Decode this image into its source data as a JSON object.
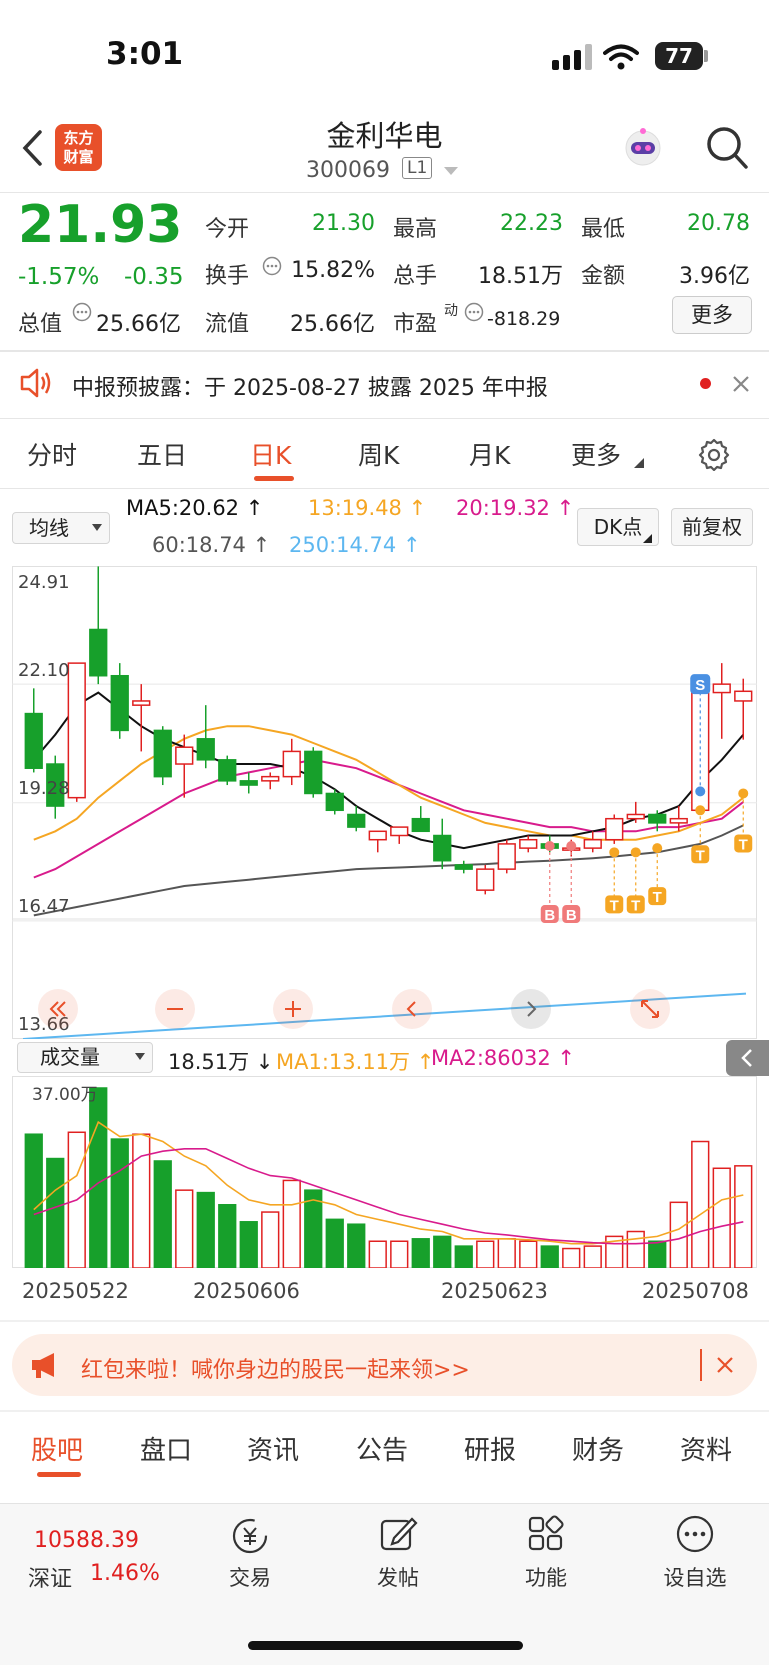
{
  "status": {
    "time": "3:01",
    "battery": "77"
  },
  "header": {
    "title": "金利华电",
    "code": "300069",
    "level": "L1",
    "logo": "东方财富"
  },
  "quote": {
    "price": "21.93",
    "pct": "-1.57%",
    "chg": "-0.35",
    "open_label": "今开",
    "open": "21.30",
    "high_label": "最高",
    "high": "22.23",
    "low_label": "最低",
    "low": "20.78",
    "turnover_label": "换手",
    "turnover": "15.82%",
    "volume_label": "总手",
    "volume": "18.51万",
    "amount_label": "金额",
    "amount": "3.96亿",
    "mktcap_label": "总值",
    "mktcap": "25.66亿",
    "float_label": "流值",
    "float": "25.66亿",
    "pe_label": "市盈",
    "pe_sup": "动",
    "pe": "-818.29",
    "more": "更多"
  },
  "notice": {
    "text": "中报预披露：于 2025-08-27 披露 2025 年中报"
  },
  "tabs": [
    "分时",
    "五日",
    "日K",
    "周K",
    "月K",
    "更多"
  ],
  "chart_controls": {
    "ma_select": "均线",
    "ma5": "MA5:20.62",
    "ma13": "13:19.48",
    "ma20": "20:19.32",
    "ma60": "60:18.74",
    "ma250": "250:14.74",
    "dk": "DK点",
    "adjust": "前复权",
    "vol_select": "成交量",
    "vol": "18.51万",
    "vol_ma1": "MA1:13.11万",
    "vol_ma2": "MA2:86032",
    "vol_top": "37.00万"
  },
  "colors": {
    "up": "#e02020",
    "down": "#17a02b",
    "ma5": "#111111",
    "ma13": "#f5a623",
    "ma20": "#d81b8c",
    "ma60": "#555555",
    "ma250": "#5db7f0",
    "accent": "#e8502a"
  },
  "chart_data": {
    "type": "candlestick",
    "y_ticks": [
      "24.91",
      "22.10",
      "19.28",
      "16.47",
      "13.66"
    ],
    "x_ticks": [
      "20250522",
      "20250606",
      "20250623",
      "20250708"
    ],
    "candles": [
      {
        "o": 21.4,
        "h": 22.0,
        "l": 20.0,
        "c": 20.1
      },
      {
        "o": 20.2,
        "h": 20.4,
        "l": 18.9,
        "c": 19.2
      },
      {
        "o": 19.4,
        "h": 22.6,
        "l": 19.3,
        "c": 22.6
      },
      {
        "o": 23.4,
        "h": 24.9,
        "l": 22.1,
        "c": 22.3
      },
      {
        "o": 22.3,
        "h": 22.6,
        "l": 20.8,
        "c": 21.0
      },
      {
        "o": 21.6,
        "h": 22.1,
        "l": 20.5,
        "c": 21.7
      },
      {
        "o": 21.0,
        "h": 21.1,
        "l": 19.7,
        "c": 19.9
      },
      {
        "o": 20.2,
        "h": 20.9,
        "l": 19.4,
        "c": 20.6
      },
      {
        "o": 20.8,
        "h": 21.6,
        "l": 20.1,
        "c": 20.3
      },
      {
        "o": 20.3,
        "h": 20.4,
        "l": 19.7,
        "c": 19.8
      },
      {
        "o": 19.8,
        "h": 20.0,
        "l": 19.5,
        "c": 19.7
      },
      {
        "o": 19.8,
        "h": 20.0,
        "l": 19.6,
        "c": 19.9
      },
      {
        "o": 19.9,
        "h": 20.8,
        "l": 19.7,
        "c": 20.5
      },
      {
        "o": 20.5,
        "h": 20.6,
        "l": 19.4,
        "c": 19.5
      },
      {
        "o": 19.5,
        "h": 19.6,
        "l": 19.0,
        "c": 19.1
      },
      {
        "o": 19.0,
        "h": 19.2,
        "l": 18.6,
        "c": 18.7
      },
      {
        "o": 18.4,
        "h": 18.5,
        "l": 18.1,
        "c": 18.6
      },
      {
        "o": 18.5,
        "h": 18.7,
        "l": 18.3,
        "c": 18.7
      },
      {
        "o": 18.9,
        "h": 19.2,
        "l": 18.8,
        "c": 18.6
      },
      {
        "o": 18.5,
        "h": 18.9,
        "l": 17.7,
        "c": 17.9
      },
      {
        "o": 17.8,
        "h": 17.9,
        "l": 17.6,
        "c": 17.7
      },
      {
        "o": 17.2,
        "h": 17.8,
        "l": 17.1,
        "c": 17.7
      },
      {
        "o": 17.7,
        "h": 18.4,
        "l": 17.6,
        "c": 18.3
      },
      {
        "o": 18.2,
        "h": 18.5,
        "l": 18.1,
        "c": 18.4
      },
      {
        "o": 18.3,
        "h": 18.5,
        "l": 18.1,
        "c": 18.2
      },
      {
        "o": 18.2,
        "h": 18.4,
        "l": 18.0,
        "c": 18.2
      },
      {
        "o": 18.2,
        "h": 18.6,
        "l": 18.1,
        "c": 18.4
      },
      {
        "o": 18.4,
        "h": 19.0,
        "l": 18.3,
        "c": 18.9
      },
      {
        "o": 18.9,
        "h": 19.3,
        "l": 18.8,
        "c": 19.0
      },
      {
        "o": 19.0,
        "h": 19.1,
        "l": 18.6,
        "c": 18.8
      },
      {
        "o": 18.8,
        "h": 19.2,
        "l": 18.6,
        "c": 18.9
      },
      {
        "o": 19.1,
        "h": 22.0,
        "l": 19.0,
        "c": 21.9
      },
      {
        "o": 21.9,
        "h": 22.6,
        "l": 20.8,
        "c": 22.1
      },
      {
        "o": 21.7,
        "h": 22.23,
        "l": 20.78,
        "c": 21.93
      }
    ],
    "ma5": [
      20.3,
      20.9,
      21.6,
      21.9,
      21.5,
      21.1,
      20.8,
      20.6,
      20.4,
      20.2,
      20.2,
      20.2,
      20.1,
      19.9,
      19.6,
      19.2,
      18.9,
      18.6,
      18.4,
      18.3,
      18.2,
      18.3,
      18.4,
      18.5,
      18.5,
      18.5,
      18.6,
      18.7,
      18.9,
      19.0,
      19.2,
      19.8,
      20.3,
      20.9
    ],
    "ma13": [
      18.4,
      18.6,
      18.9,
      19.4,
      19.8,
      20.2,
      20.5,
      20.8,
      21.0,
      21.1,
      21.1,
      21.0,
      20.9,
      20.7,
      20.5,
      20.3,
      20.0,
      19.7,
      19.4,
      19.2,
      19.0,
      18.8,
      18.7,
      18.6,
      18.5,
      18.5,
      18.4,
      18.4,
      18.4,
      18.5,
      18.6,
      18.8,
      19.0,
      19.4
    ],
    "ma20": [
      17.5,
      17.7,
      18.0,
      18.3,
      18.6,
      18.9,
      19.2,
      19.5,
      19.7,
      19.9,
      20.0,
      20.1,
      20.2,
      20.3,
      20.2,
      20.1,
      19.9,
      19.7,
      19.5,
      19.3,
      19.1,
      19.0,
      18.9,
      18.8,
      18.7,
      18.7,
      18.6,
      18.6,
      18.6,
      18.7,
      18.7,
      18.8,
      18.9,
      19.3
    ],
    "ma60": [
      16.6,
      16.7,
      16.8,
      16.9,
      17.0,
      17.1,
      17.2,
      17.3,
      17.35,
      17.4,
      17.45,
      17.5,
      17.55,
      17.6,
      17.65,
      17.7,
      17.72,
      17.74,
      17.76,
      17.78,
      17.8,
      17.82,
      17.85,
      17.88,
      17.9,
      17.93,
      17.96,
      18.0,
      18.05,
      18.1,
      18.2,
      18.3,
      18.5,
      18.74
    ],
    "ma250": [
      13.66,
      13.72,
      13.78,
      13.84,
      13.9,
      13.96,
      14.02,
      14.08,
      14.14,
      14.2,
      14.26,
      14.32,
      14.38,
      14.44,
      14.5,
      14.56,
      14.62,
      14.68,
      14.74
    ],
    "volume": [
      27.5,
      22.5,
      27.9,
      37.0,
      26.5,
      27.5,
      22.0,
      16.0,
      15.5,
      13.0,
      9.5,
      11.5,
      18.0,
      16.0,
      10.0,
      9.0,
      5.5,
      5.5,
      6.0,
      6.5,
      4.5,
      5.5,
      6.0,
      5.5,
      4.5,
      4.0,
      4.5,
      6.5,
      7.5,
      5.5,
      13.5,
      26.0,
      20.5,
      21.0
    ],
    "vol_ma1": [
      12.0,
      16.0,
      19.0,
      30.0,
      27.0,
      27.5,
      26.0,
      23.0,
      21.0,
      17.0,
      14.0,
      13.0,
      13.0,
      14.0,
      13.0,
      11.0,
      10.0,
      9.0,
      8.0,
      7.5,
      6.0,
      6.0,
      6.0,
      5.8,
      5.5,
      5.0,
      5.0,
      5.5,
      6.0,
      6.5,
      8.0,
      11.0,
      14.0,
      15.0
    ],
    "vol_ma2": [
      11.0,
      12.5,
      14.0,
      17.5,
      20.0,
      23.0,
      24.0,
      24.5,
      24.5,
      22.5,
      20.5,
      19.0,
      18.5,
      17.0,
      15.5,
      14.0,
      12.5,
      11.0,
      10.0,
      9.0,
      8.0,
      7.2,
      6.8,
      6.3,
      5.8,
      5.5,
      5.2,
      5.0,
      5.0,
      5.2,
      6.0,
      7.5,
      8.6,
      9.5
    ]
  },
  "promo": {
    "text": "红包来啦！喊你身边的股民一起来领>>"
  },
  "bottom_tabs": [
    "股吧",
    "盘口",
    "资讯",
    "公告",
    "研报",
    "财务",
    "资料"
  ],
  "index": {
    "value": "10588.39",
    "name": "深证",
    "pct": "1.46%"
  },
  "nav": [
    "交易",
    "发帖",
    "功能",
    "设自选"
  ]
}
